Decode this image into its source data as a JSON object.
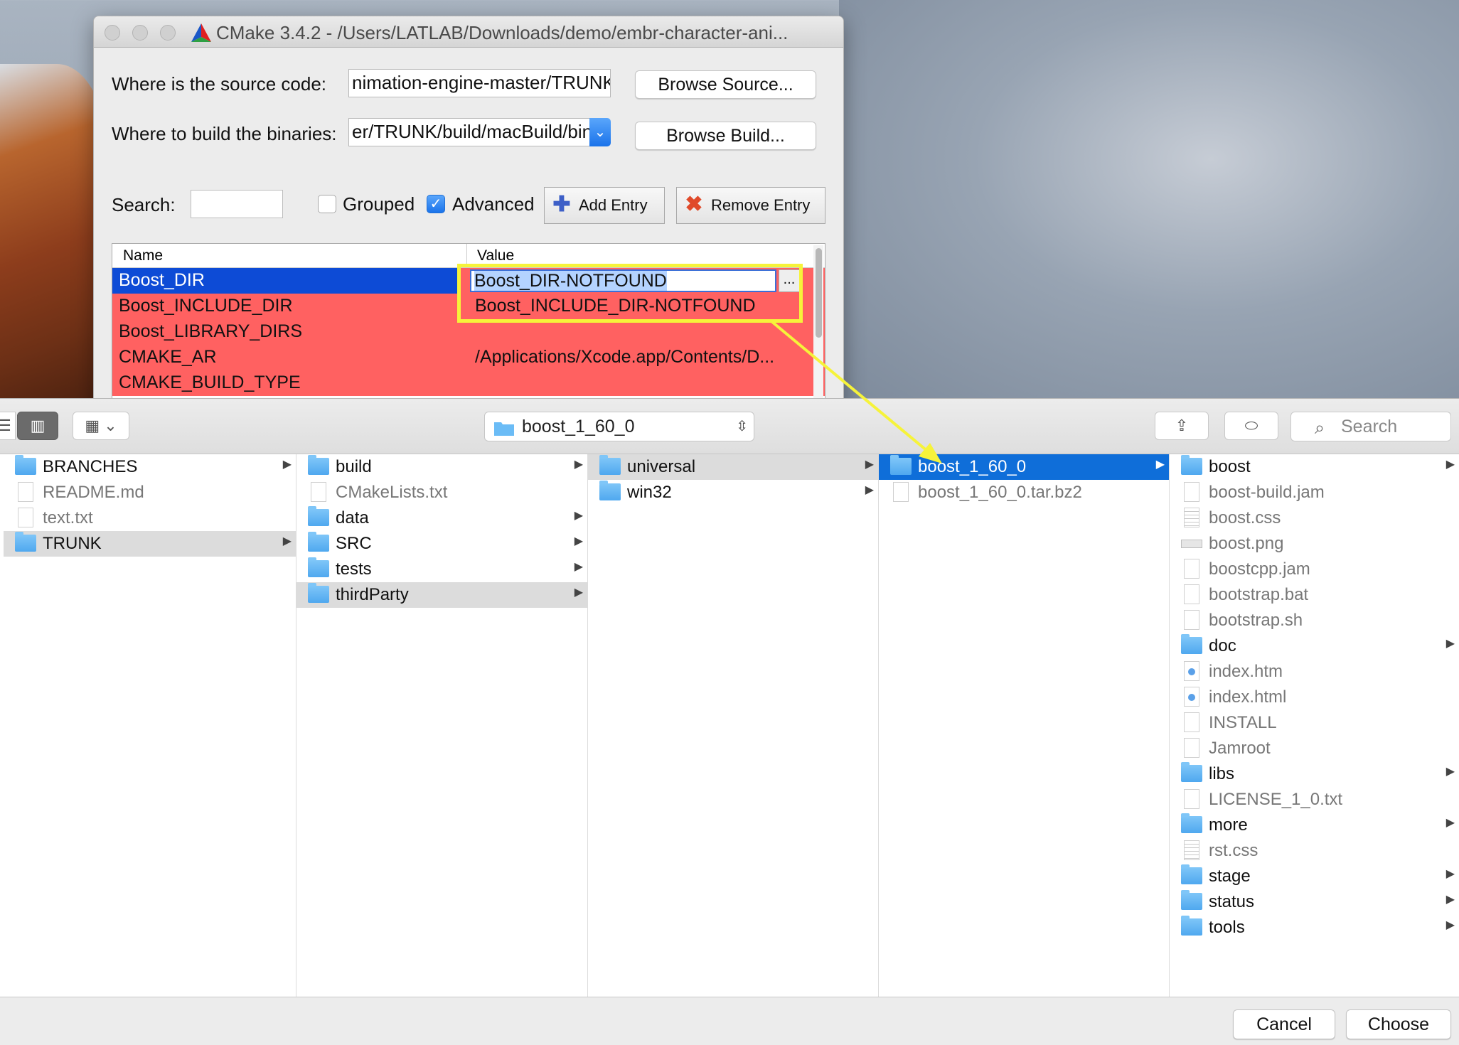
{
  "cmake": {
    "title": "CMake 3.4.2 - /Users/LATLAB/Downloads/demo/embr-character-ani...",
    "source_label": "Where is the source code:",
    "source_value": "nimation-engine-master/TRUNK",
    "browse_source": "Browse Source...",
    "build_label": "Where to build the binaries:",
    "build_value": "er/TRUNK/build/macBuild/bin",
    "browse_build": "Browse Build...",
    "search_label": "Search:",
    "search_value": "",
    "grouped_label": "Grouped",
    "grouped_checked": false,
    "advanced_label": "Advanced",
    "advanced_checked": true,
    "add_entry": "Add Entry",
    "remove_entry": "Remove Entry",
    "table": {
      "col_name": "Name",
      "col_value": "Value",
      "ellipsis": "...",
      "rows": [
        {
          "name": "Boost_DIR",
          "value": "Boost_DIR-NOTFOUND"
        },
        {
          "name": "Boost_INCLUDE_DIR",
          "value": "Boost_INCLUDE_DIR-NOTFOUND"
        },
        {
          "name": "Boost_LIBRARY_DIRS",
          "value": ""
        },
        {
          "name": "CMAKE_AR",
          "value": "/Applications/Xcode.app/Contents/D..."
        },
        {
          "name": "CMAKE_BUILD_TYPE",
          "value": ""
        }
      ]
    }
  },
  "dialog": {
    "path_popup": "boost_1_60_0",
    "search_placeholder": "Search",
    "cancel": "Cancel",
    "choose": "Choose",
    "columns": [
      [
        {
          "label": "BRANCHES",
          "kind": "folder"
        },
        {
          "label": "README.md",
          "kind": "file"
        },
        {
          "label": "text.txt",
          "kind": "file"
        },
        {
          "label": "TRUNK",
          "kind": "folder"
        }
      ],
      [
        {
          "label": "build",
          "kind": "folder"
        },
        {
          "label": "CMakeLists.txt",
          "kind": "file"
        },
        {
          "label": "data",
          "kind": "folder"
        },
        {
          "label": "SRC",
          "kind": "folder"
        },
        {
          "label": "tests",
          "kind": "folder"
        },
        {
          "label": "thirdParty",
          "kind": "folder"
        }
      ],
      [
        {
          "label": "universal",
          "kind": "folder"
        },
        {
          "label": "win32",
          "kind": "folder"
        }
      ],
      [
        {
          "label": "boost_1_60_0",
          "kind": "folder"
        },
        {
          "label": "boost_1_60_0.tar.bz2",
          "kind": "file"
        }
      ],
      [
        {
          "label": "boost",
          "kind": "folder"
        },
        {
          "label": "boost-build.jam",
          "kind": "file"
        },
        {
          "label": "boost.css",
          "kind": "file"
        },
        {
          "label": "boost.png",
          "kind": "file"
        },
        {
          "label": "boostcpp.jam",
          "kind": "file"
        },
        {
          "label": "bootstrap.bat",
          "kind": "file"
        },
        {
          "label": "bootstrap.sh",
          "kind": "file"
        },
        {
          "label": "doc",
          "kind": "folder"
        },
        {
          "label": "index.htm",
          "kind": "file"
        },
        {
          "label": "index.html",
          "kind": "file"
        },
        {
          "label": "INSTALL",
          "kind": "file"
        },
        {
          "label": "Jamroot",
          "kind": "file"
        },
        {
          "label": "libs",
          "kind": "folder"
        },
        {
          "label": "LICENSE_1_0.txt",
          "kind": "file"
        },
        {
          "label": "more",
          "kind": "folder"
        },
        {
          "label": "rst.css",
          "kind": "file"
        },
        {
          "label": "stage",
          "kind": "folder"
        },
        {
          "label": "status",
          "kind": "folder"
        },
        {
          "label": "tools",
          "kind": "folder"
        }
      ]
    ]
  },
  "colors": {
    "annotation": "#f6f33a",
    "error_row": "#ff6161",
    "selection_blue": "#0f6ed9"
  }
}
